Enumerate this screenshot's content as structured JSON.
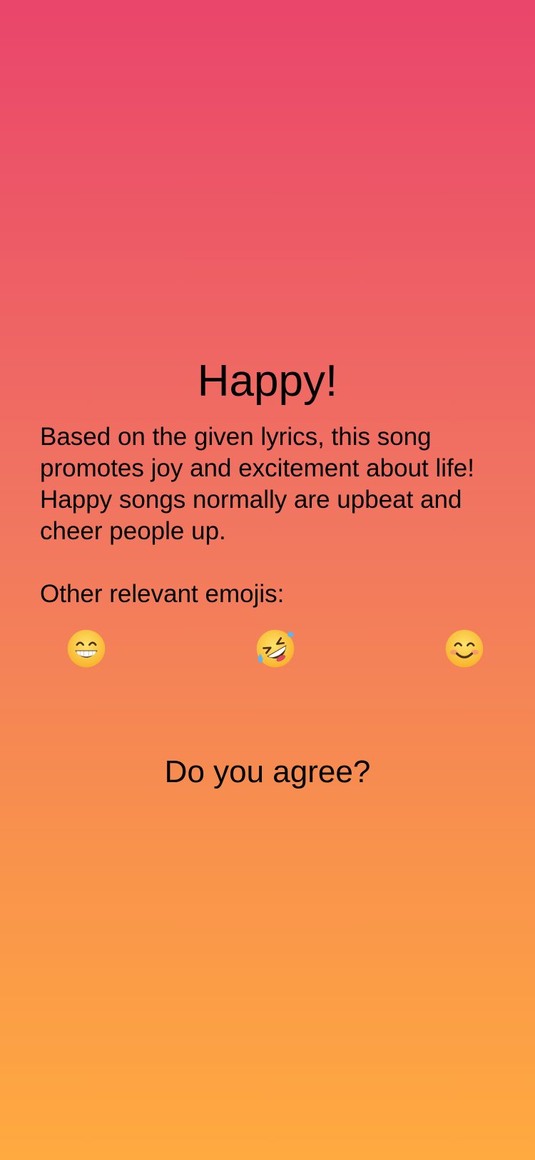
{
  "result": {
    "title": "Happy!",
    "description": "Based on the given lyrics, this song promotes joy and excitement about life! Happy songs normally are upbeat and cheer people up.",
    "emoji_label": "Other relevant emojis:",
    "emojis": [
      {
        "icon": "grinning-face-with-smiling-eyes-icon",
        "char": "😁"
      },
      {
        "icon": "rolling-on-the-floor-laughing-icon",
        "char": "🤣"
      },
      {
        "icon": "smiling-face-with-smiling-eyes-icon",
        "char": "😊"
      }
    ],
    "question": "Do you agree?"
  },
  "colors": {
    "gradient_top": "#EA456B",
    "gradient_bottom": "#FFAA40",
    "text": "#000000"
  }
}
